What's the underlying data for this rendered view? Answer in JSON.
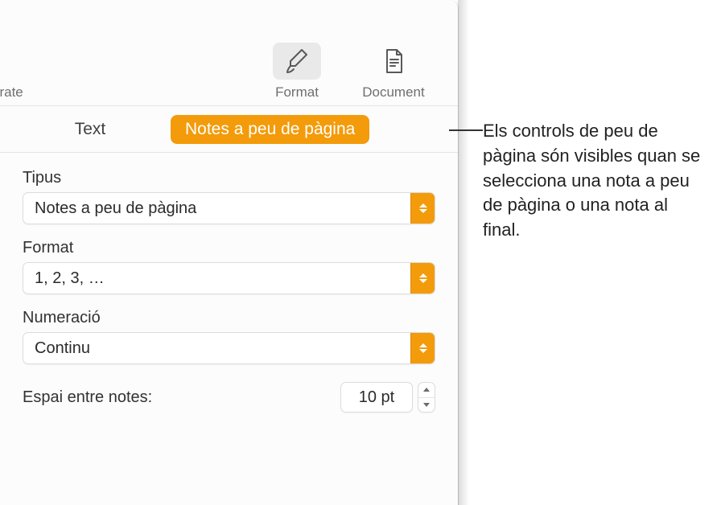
{
  "toolbar": {
    "left_partial_label": "orate",
    "format_label": "Format",
    "document_label": "Document"
  },
  "tabs": {
    "text_label": "Text",
    "footnotes_label": "Notes a peu de pàgina"
  },
  "form": {
    "type_label": "Tipus",
    "type_value": "Notes a peu de pàgina",
    "format_label": "Format",
    "format_value": "1, 2, 3, …",
    "numbering_label": "Numeració",
    "numbering_value": "Continu",
    "spacing_label": "Espai entre notes:",
    "spacing_value": "10 pt"
  },
  "callout": {
    "text": "Els controls de peu de pàgina són visibles quan se selecciona una nota a peu de pàgina o una nota al final."
  }
}
